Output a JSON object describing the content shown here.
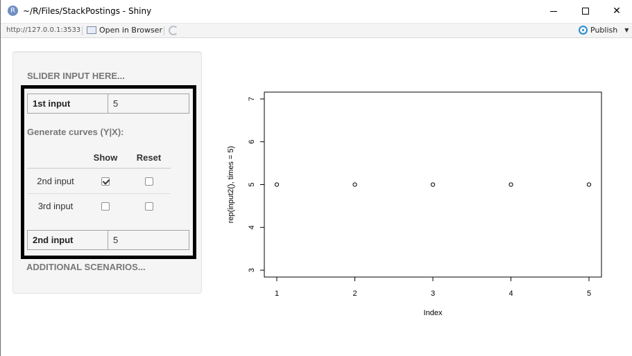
{
  "window": {
    "title": "~/R/Files/StackPostings - Shiny",
    "app_icon_letter": "R"
  },
  "addressbar": {
    "url": "http://127.0.0.1:3533",
    "open_browser_label": "Open in Browser",
    "publish_label": "Publish"
  },
  "sidebar": {
    "title_top": "SLIDER INPUT HERE...",
    "title_bottom": "ADDITIONAL SCENARIOS...",
    "input1": {
      "label": "1st input",
      "value": "5"
    },
    "generate_label": "Generate curves (Y|X):",
    "table": {
      "headers": [
        "",
        "Show",
        "Reset"
      ],
      "rows": [
        {
          "name": "2nd input",
          "show": true,
          "reset": false
        },
        {
          "name": "3rd input",
          "show": false,
          "reset": false
        }
      ]
    },
    "input2": {
      "label": "2nd input",
      "value": "5"
    }
  },
  "chart_data": {
    "type": "scatter",
    "x": [
      1,
      2,
      3,
      4,
      5
    ],
    "y": [
      5,
      5,
      5,
      5,
      5
    ],
    "xlabel": "Index",
    "ylabel": "rep(input2(), times = 5)",
    "xlim": [
      1,
      5
    ],
    "ylim": [
      3,
      7
    ],
    "xticks": [
      "1",
      "2",
      "3",
      "4",
      "5"
    ],
    "yticks": [
      "3",
      "4",
      "5",
      "6",
      "7"
    ],
    "marker": "open-circle",
    "grid": false
  }
}
